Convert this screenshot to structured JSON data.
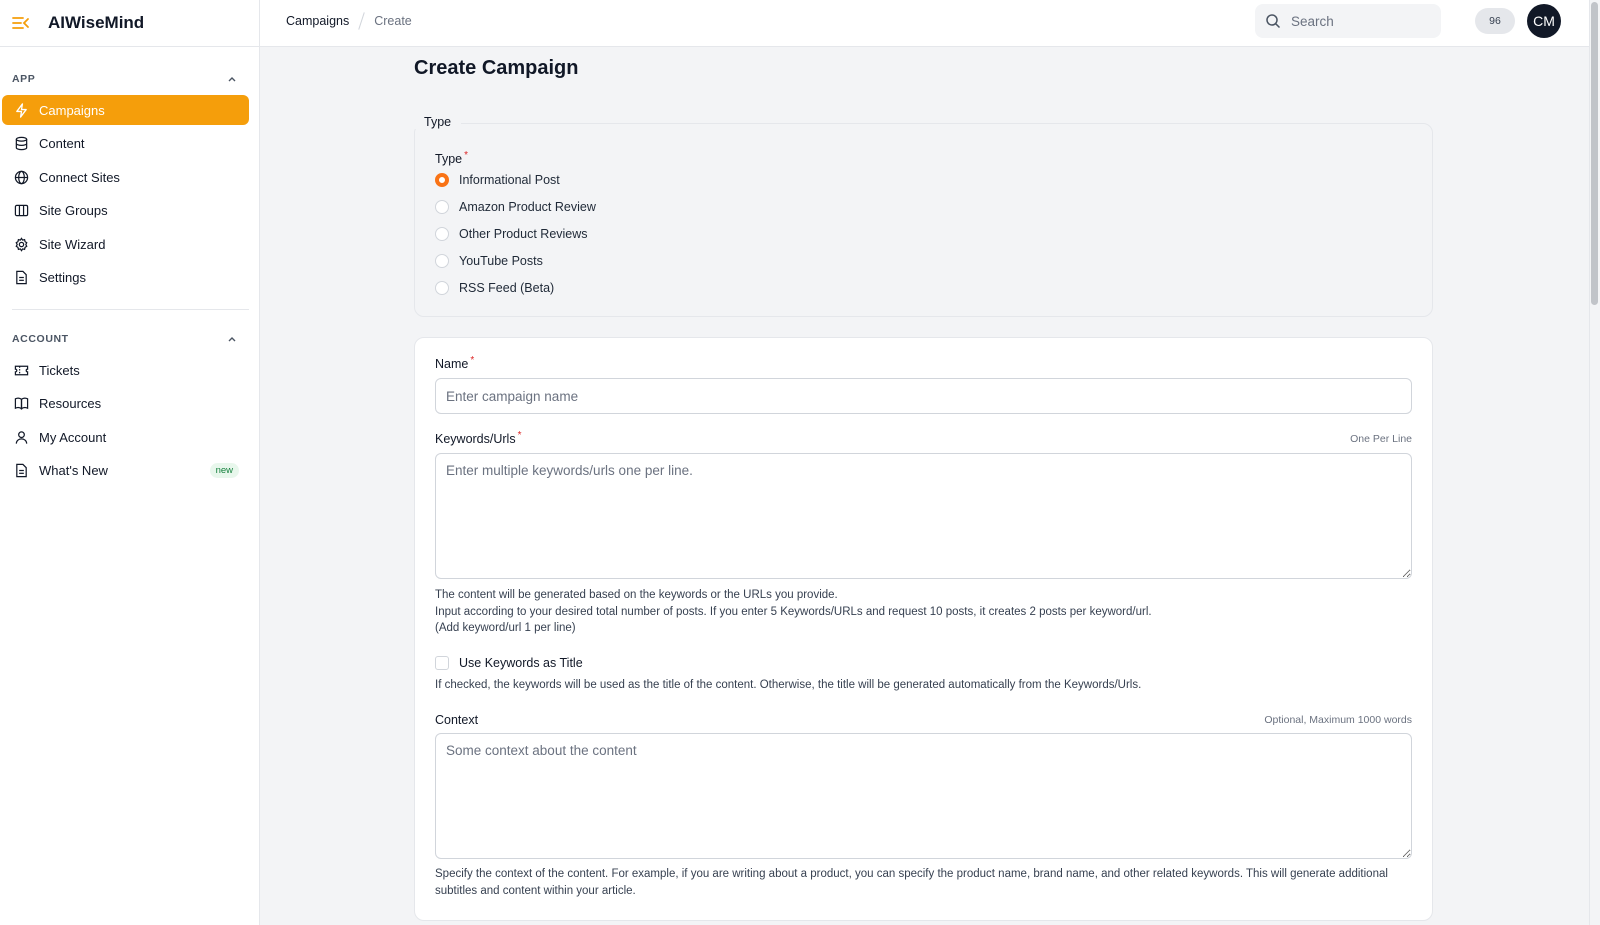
{
  "app": {
    "name": "AIWiseMind"
  },
  "sidebar": {
    "app_section": "APP",
    "app_items": [
      {
        "label": "Campaigns",
        "icon": "bolt-icon",
        "active": true
      },
      {
        "label": "Content",
        "icon": "database-icon"
      },
      {
        "label": "Connect Sites",
        "icon": "globe-icon"
      },
      {
        "label": "Site Groups",
        "icon": "columns-icon"
      },
      {
        "label": "Site Wizard",
        "icon": "gear-icon"
      },
      {
        "label": "Settings",
        "icon": "document-icon"
      }
    ],
    "account_section": "ACCOUNT",
    "account_items": [
      {
        "label": "Tickets",
        "icon": "ticket-icon"
      },
      {
        "label": "Resources",
        "icon": "book-icon"
      },
      {
        "label": "My Account",
        "icon": "user-icon"
      },
      {
        "label": "What's New",
        "icon": "document-icon",
        "badge": "new"
      }
    ]
  },
  "header": {
    "breadcrumb": [
      "Campaigns",
      "Create"
    ],
    "search_placeholder": "Search",
    "credits": "96",
    "avatar_initials": "CM"
  },
  "page": {
    "title": "Create Campaign",
    "type_section": {
      "legend": "Type",
      "label": "Type",
      "options": [
        "Informational Post",
        "Amazon Product Review",
        "Other Product Reviews",
        "YouTube Posts",
        "RSS Feed (Beta)"
      ],
      "selected": "Informational Post"
    },
    "form": {
      "name_label": "Name",
      "name_placeholder": "Enter campaign name",
      "keywords_label": "Keywords/Urls",
      "keywords_hint": "One Per Line",
      "keywords_placeholder": "Enter multiple keywords/urls one per line.",
      "keywords_help": [
        "The content will be generated based on the keywords or the URLs you provide.",
        "Input according to your desired total number of posts. If you enter 5 Keywords/URLs and request 10 posts, it creates 2 posts per keyword/url.",
        "(Add keyword/url 1 per line)"
      ],
      "use_keywords_label": "Use Keywords as Title",
      "use_keywords_help": "If checked, the keywords will be used as the title of the content. Otherwise, the title will be generated automatically from the Keywords/Urls.",
      "context_label": "Context",
      "context_hint": "Optional, Maximum 1000 words",
      "context_placeholder": "Some context about the content",
      "context_help": "Specify the context of the content. For example, if you are writing about a product, you can specify the product name, brand name, and other related keywords. This will generate additional subtitles and content within your article."
    }
  },
  "colors": {
    "accent": "#f59e0b",
    "radio_accent": "#f97316",
    "required": "#dc2626"
  }
}
